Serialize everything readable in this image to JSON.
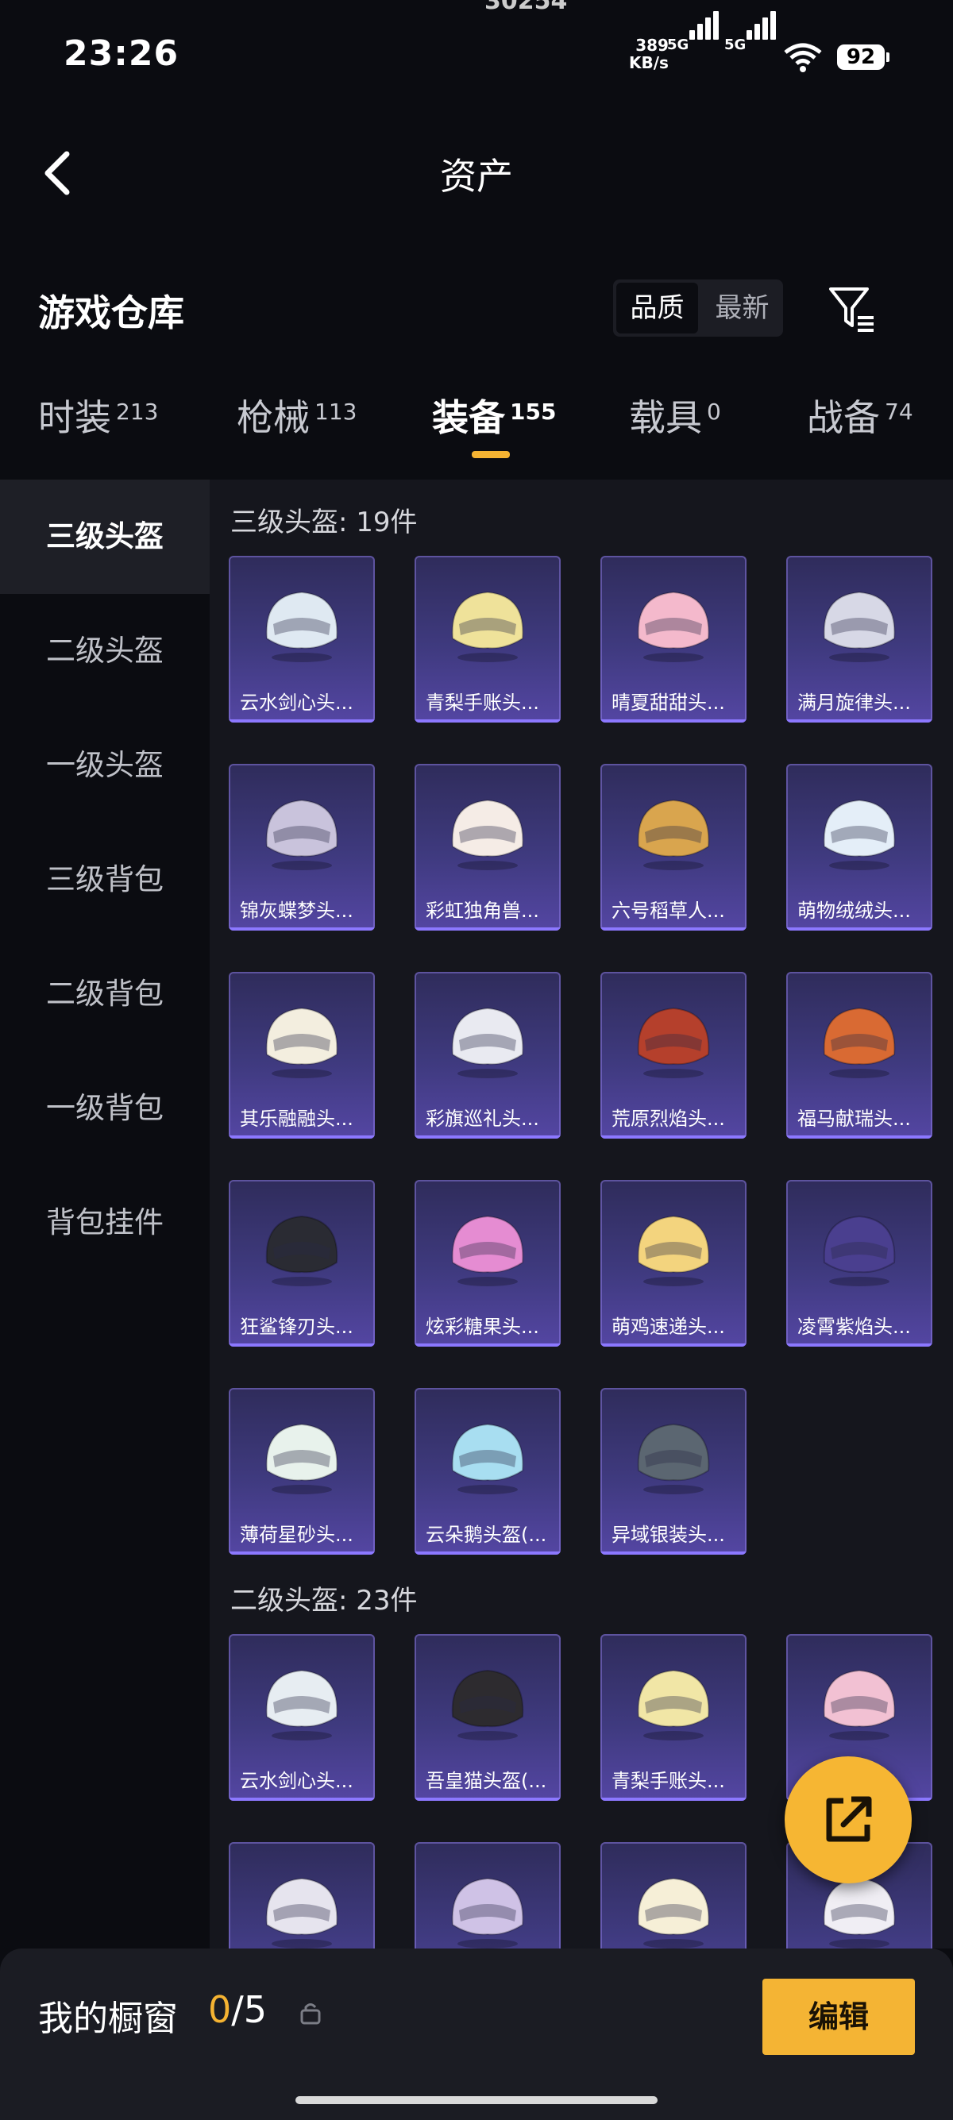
{
  "status_bar": {
    "top_cut_text": "30254",
    "time": "23:26",
    "net_speed_value": "389",
    "net_speed_unit": "KB/s",
    "network_1": "5G",
    "network_2": "5G",
    "battery": "92"
  },
  "nav": {
    "title": "资产"
  },
  "warehouse": {
    "title": "游戏仓库",
    "sort_options": [
      "品质",
      "最新"
    ],
    "active_sort": "品质"
  },
  "tabs": [
    {
      "label": "时装",
      "count": "213"
    },
    {
      "label": "枪械",
      "count": "113"
    },
    {
      "label": "装备",
      "count": "155"
    },
    {
      "label": "载具",
      "count": "0"
    },
    {
      "label": "战备",
      "count": "74"
    }
  ],
  "active_tab": "装备",
  "sidebar": [
    "三级头盔",
    "二级头盔",
    "一级头盔",
    "三级背包",
    "二级背包",
    "一级背包",
    "背包挂件"
  ],
  "active_sidebar": "三级头盔",
  "sections": [
    {
      "title": "三级头盔: 19件",
      "items": [
        "云水剑心头...",
        "青梨手账头...",
        "晴夏甜甜头...",
        "满月旋律头...",
        "锦灰蝶梦头...",
        "彩虹独角兽...",
        "六号稻草人...",
        "萌物绒绒头...",
        "其乐融融头...",
        "彩旗巡礼头...",
        "荒原烈焰头...",
        "福马献瑞头...",
        "狂鲨锋刃头...",
        "炫彩糖果头...",
        "萌鸡速递头...",
        "凌霄紫焰头...",
        "薄荷星砂头...",
        "云朵鹅头盔(...",
        "异域银装头..."
      ]
    },
    {
      "title": "二级头盔: 23件",
      "items": [
        "云水剑心头...",
        "吾皇猫头盔(...",
        "青梨手账头...",
        "",
        "",
        "",
        "",
        ""
      ]
    }
  ],
  "helmet_colors": [
    "#dfe9f2",
    "#efe29a",
    "#f4b9cc",
    "#d7d8e6",
    "#c9c3dc",
    "#f5ece6",
    "#d9a54e",
    "#e4eef8",
    "#f3eedf",
    "#e9eaf1",
    "#b5402c",
    "#d96a33",
    "#2a2b33",
    "#e58cd2",
    "#f3d47e",
    "#4a3f8f",
    "#e8f2ec",
    "#a8def1",
    "#5b6671",
    "#e7edf2",
    "#2d2b2f",
    "#f1e6a6",
    "#f2c1d3",
    "#e6e4ee",
    "#cfc2e6",
    "#f6efd7",
    "#f0eef4"
  ],
  "bottom": {
    "showcase_label": "我的橱窗",
    "showcase_current": "0",
    "showcase_total": "/5",
    "edit_label": "编辑"
  },
  "accent_color": "#f5b332"
}
